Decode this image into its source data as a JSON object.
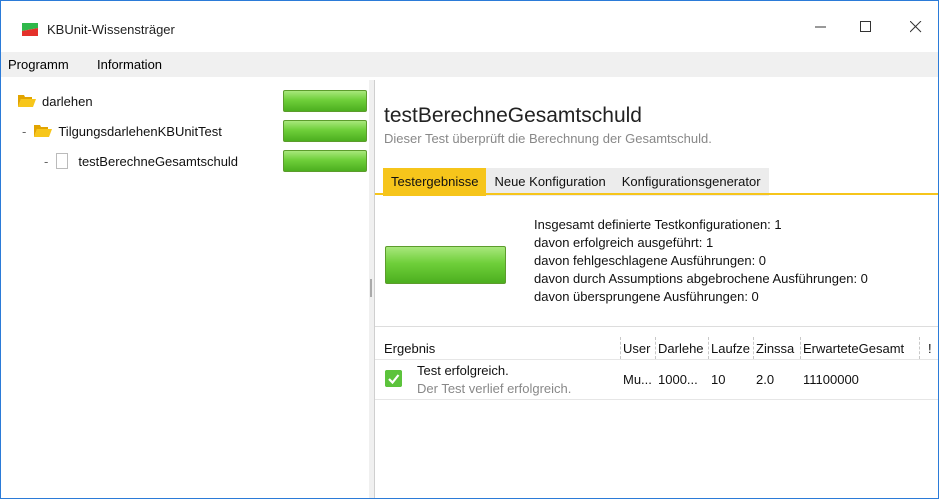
{
  "window": {
    "title": "KBUnit-Wissensträger",
    "minimize": "—",
    "maximize": "☐",
    "close": "✕"
  },
  "menu": [
    "Programm",
    "Information"
  ],
  "tree": [
    {
      "label": "darlehen",
      "status": "passed"
    },
    {
      "label": "TilgungsdarlehenKBUnitTest",
      "status": "passed"
    },
    {
      "label": "testBerechneGesamtschuld",
      "status": "passed"
    }
  ],
  "tree_dash": "-",
  "main": {
    "title": "testBerechneGesamtschuld",
    "description": "Dieser Test überprüft die Berechnung der Gesamtschuld.",
    "tabs": [
      "Testergebnisse",
      "Neue Konfiguration",
      "Konfigurationsgenerator"
    ],
    "active_tab": 0,
    "stats": [
      "Insgesamt definierte Testkonfigurationen: 1",
      "davon erfolgreich ausgeführt: 1",
      "davon fehlgeschlagene Ausführungen: 0",
      "davon durch Assumptions abgebrochene Ausführungen: 0",
      "davon übersprungene Ausführungen: 0"
    ]
  },
  "table": {
    "columns": [
      "Ergebnis",
      "User",
      "Darlehe",
      "Laufze",
      "Zinssa",
      "ErwarteteGesamt",
      "!"
    ],
    "rows": [
      {
        "result_title": "Test erfolgreich.",
        "result_sub": "Der Test verlief erfolgreich.",
        "user": "Mu...",
        "darlehen": "1000...",
        "laufzeit": "10",
        "zinssatz": "2.0",
        "erwartet": "11100000",
        "extra": ""
      }
    ]
  },
  "colors": {
    "accent_tab": "#f6c51b",
    "progress_green": "#6fcf3a",
    "check_green": "#5cc33c",
    "window_border": "#2b7bd8"
  },
  "icons": [
    "app-logo-icon",
    "folder-open-icon",
    "file-icon",
    "checkmark-icon"
  ]
}
